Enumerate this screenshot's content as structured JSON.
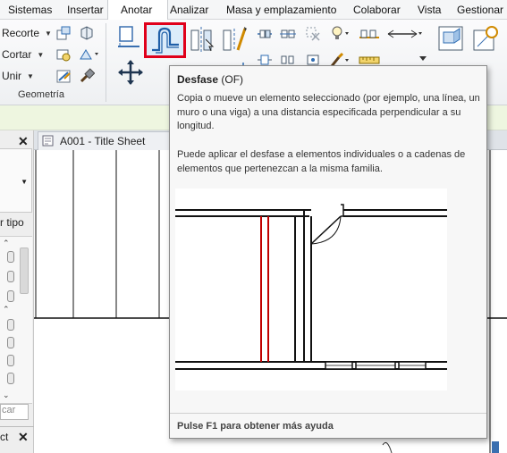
{
  "menu": {
    "tabs": [
      "Sistemas",
      "Insertar",
      "Anotar",
      "Analizar",
      "Masa y emplazamiento",
      "Colaborar",
      "Vista",
      "Gestionar"
    ]
  },
  "ribbon": {
    "recorte_label": "Recorte",
    "cortar_label": "Cortar",
    "unir_label": "Unir",
    "group_label": "Geometría",
    "highlight_color": "#e0001b"
  },
  "left_panel": {
    "type_label": "r tipo",
    "search_placeholder": "car",
    "bottom_label": "ct"
  },
  "view": {
    "tab_label": "A001 - Title Sheet"
  },
  "tooltip": {
    "title": "Desfase",
    "shortcut": "(OF)",
    "description": "Copia o mueve un elemento seleccionado (por ejemplo, una línea, un muro o una viga) a una distancia especificada perpendicular a su longitud.",
    "detail": "Puede aplicar el desfase a elementos individuales o a cadenas de elementos que pertenezcan a la misma familia.",
    "footer": "Pulse F1 para obtener más ayuda",
    "accent_color": "#c00000"
  }
}
